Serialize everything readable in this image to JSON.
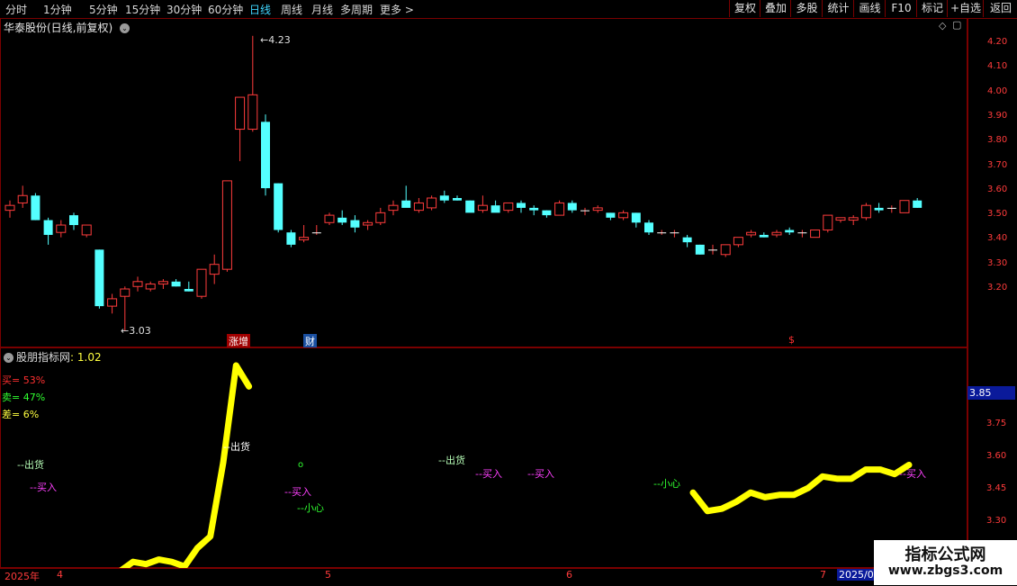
{
  "toolbar": {
    "timeframes": [
      "分时",
      "1分钟",
      "5分钟",
      "15分钟",
      "30分钟",
      "60分钟",
      "日线",
      "周线",
      "月线",
      "多周期",
      "更多 >"
    ],
    "active": "日线",
    "buttons": [
      "复权",
      "叠加",
      "多股",
      "统计",
      "画线",
      "F10",
      "标记",
      "+自选",
      "返回"
    ]
  },
  "main": {
    "title": "华泰股份(日线,前复权)",
    "high_label": "4.23",
    "low_label": "3.03",
    "y_ticks": [
      "4.20",
      "4.10",
      "4.00",
      "3.90",
      "3.80",
      "3.70",
      "3.60",
      "3.50",
      "3.40",
      "3.30",
      "3.20"
    ],
    "event_tags": [
      "涨增",
      "财",
      "$"
    ]
  },
  "indicator": {
    "title": "股朋指标网",
    "value": ": 1.02",
    "buy": "买= 53%",
    "sell": "卖= 47%",
    "diff": "差= 6%",
    "y_ticks": [
      "3.75",
      "3.60",
      "3.45",
      "3.30"
    ],
    "current_value": "3.85",
    "annotations": [
      "--出货",
      "--买入",
      "--出货",
      "--买入",
      "--小心",
      "--出货",
      "--买入",
      "--买入",
      "--小心",
      "--买入"
    ],
    "dot": "o"
  },
  "timeline": {
    "labels": [
      "2025年",
      "4",
      "5",
      "6",
      "7",
      "2025/07"
    ]
  },
  "watermark": {
    "title": "指标公式网",
    "url": "www.zbgs3.com"
  },
  "chart_data": {
    "type": "candlestick",
    "ylim": [
      3.0,
      4.3
    ],
    "candles": [
      [
        3.52,
        3.56,
        3.49,
        3.54
      ],
      [
        3.55,
        3.62,
        3.53,
        3.58
      ],
      [
        3.58,
        3.59,
        3.48,
        3.48
      ],
      [
        3.48,
        3.49,
        3.38,
        3.42
      ],
      [
        3.43,
        3.48,
        3.41,
        3.46
      ],
      [
        3.5,
        3.51,
        3.44,
        3.46
      ],
      [
        3.42,
        3.45,
        3.41,
        3.46
      ],
      [
        3.36,
        3.36,
        3.12,
        3.13
      ],
      [
        3.13,
        3.18,
        3.1,
        3.16
      ],
      [
        3.17,
        3.21,
        3.03,
        3.2
      ],
      [
        3.21,
        3.25,
        3.19,
        3.23
      ],
      [
        3.2,
        3.23,
        3.19,
        3.22
      ],
      [
        3.22,
        3.24,
        3.2,
        3.23
      ],
      [
        3.23,
        3.24,
        3.21,
        3.21
      ],
      [
        3.2,
        3.23,
        3.19,
        3.19
      ],
      [
        3.17,
        3.27,
        3.16,
        3.28
      ],
      [
        3.26,
        3.34,
        3.22,
        3.3
      ],
      [
        3.28,
        3.64,
        3.27,
        3.64
      ],
      [
        3.85,
        3.91,
        3.72,
        3.98
      ],
      [
        3.85,
        4.23,
        3.84,
        3.99
      ],
      [
        3.88,
        3.91,
        3.58,
        3.61
      ],
      [
        3.63,
        3.63,
        3.43,
        3.44
      ],
      [
        3.43,
        3.44,
        3.37,
        3.38
      ],
      [
        3.4,
        3.46,
        3.39,
        3.41
      ],
      [
        3.43,
        3.46,
        3.42,
        3.43
      ],
      [
        3.47,
        3.51,
        3.46,
        3.5
      ],
      [
        3.49,
        3.52,
        3.46,
        3.47
      ],
      [
        3.48,
        3.5,
        3.43,
        3.45
      ],
      [
        3.46,
        3.48,
        3.44,
        3.47
      ],
      [
        3.47,
        3.53,
        3.46,
        3.51
      ],
      [
        3.52,
        3.56,
        3.5,
        3.54
      ],
      [
        3.56,
        3.62,
        3.54,
        3.53
      ],
      [
        3.52,
        3.57,
        3.51,
        3.55
      ],
      [
        3.53,
        3.58,
        3.52,
        3.57
      ],
      [
        3.58,
        3.6,
        3.55,
        3.56
      ],
      [
        3.57,
        3.58,
        3.56,
        3.56
      ],
      [
        3.56,
        3.56,
        3.52,
        3.51
      ],
      [
        3.52,
        3.58,
        3.51,
        3.54
      ],
      [
        3.54,
        3.56,
        3.52,
        3.51
      ],
      [
        3.52,
        3.55,
        3.51,
        3.55
      ],
      [
        3.55,
        3.56,
        3.51,
        3.53
      ],
      [
        3.53,
        3.54,
        3.5,
        3.52
      ],
      [
        3.52,
        3.52,
        3.49,
        3.5
      ],
      [
        3.5,
        3.56,
        3.5,
        3.55
      ],
      [
        3.55,
        3.56,
        3.51,
        3.52
      ],
      [
        3.52,
        3.53,
        3.5,
        3.52
      ],
      [
        3.52,
        3.54,
        3.51,
        3.53
      ],
      [
        3.51,
        3.51,
        3.48,
        3.49
      ],
      [
        3.49,
        3.52,
        3.48,
        3.51
      ],
      [
        3.51,
        3.51,
        3.45,
        3.47
      ],
      [
        3.47,
        3.48,
        3.42,
        3.43
      ],
      [
        3.43,
        3.44,
        3.42,
        3.43
      ],
      [
        3.43,
        3.44,
        3.41,
        3.43
      ],
      [
        3.41,
        3.42,
        3.37,
        3.39
      ],
      [
        3.38,
        3.38,
        3.34,
        3.34
      ],
      [
        3.36,
        3.38,
        3.34,
        3.36
      ],
      [
        3.34,
        3.38,
        3.33,
        3.38
      ],
      [
        3.38,
        3.41,
        3.37,
        3.41
      ],
      [
        3.42,
        3.44,
        3.41,
        3.43
      ],
      [
        3.42,
        3.43,
        3.41,
        3.41
      ],
      [
        3.42,
        3.44,
        3.41,
        3.43
      ],
      [
        3.44,
        3.45,
        3.42,
        3.43
      ],
      [
        3.43,
        3.44,
        3.41,
        3.43
      ],
      [
        3.41,
        3.44,
        3.41,
        3.44
      ],
      [
        3.44,
        3.5,
        3.43,
        3.5
      ],
      [
        3.48,
        3.49,
        3.47,
        3.49
      ],
      [
        3.48,
        3.5,
        3.46,
        3.49
      ],
      [
        3.49,
        3.55,
        3.48,
        3.54
      ],
      [
        3.53,
        3.55,
        3.51,
        3.52
      ],
      [
        3.53,
        3.54,
        3.51,
        3.53
      ],
      [
        3.51,
        3.56,
        3.51,
        3.56
      ],
      [
        3.56,
        3.57,
        3.53,
        3.53
      ]
    ],
    "indicator_line": {
      "seg1": [
        3.02,
        3.06,
        3.08,
        3.12,
        3.11,
        3.13,
        3.12,
        3.1,
        3.18,
        3.23,
        3.55,
        4.0,
        3.88
      ],
      "seg2": [
        3.42,
        3.34,
        3.35,
        3.38,
        3.42,
        3.4,
        3.41,
        3.41,
        3.44,
        3.49,
        3.48,
        3.48,
        3.52,
        3.52,
        3.5,
        3.54
      ]
    }
  }
}
